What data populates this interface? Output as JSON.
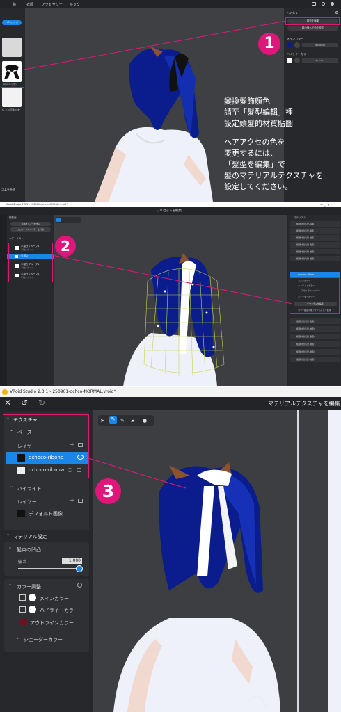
{
  "p1": {
    "tabs": [
      "體",
      "衣服",
      "アクセサリー",
      "ルック"
    ],
    "left": {
      "top_button": "ヘアスタイル",
      "item_caption": "qchoco-リボン",
      "item2_caption": "Tu_リ-ル宣言3/2枚"
    },
    "bottom": "ゴムを外す",
    "right": {
      "title": "ヘアカラー",
      "edit_button": "髪型を編集",
      "reset_button": "最小値ヘア色を設定",
      "main_label": "メインカラー",
      "main_hex": "#000000",
      "hl_label": "ハイライトカラー",
      "hl_hex": "#FFFFFF"
    },
    "note_zh": [
      "變換髮飾顏色",
      "請至「髮型編輯」裡",
      "設定頭髮的材質貼圖"
    ],
    "note_jp": [
      "ヘアアクセの色を",
      "変更するには、",
      "「髪型を編集」で",
      "髪のマテリアルテクスチャを",
      "設定してください。"
    ],
    "badge": "1"
  },
  "p2": {
    "window_title": "VRoid Studio 2.3.1 - 250901-qchco-NORMAL.vroid*",
    "header_title": "プリセットを編集",
    "left": {
      "title": "編集画",
      "btn1": "手描きヘアーを作る",
      "btn2": "プロシージャルヘアーを作る",
      "section": "ヘアーリスト",
      "groups": [
        "手描きグループ1",
        "手描きグループ1",
        "手描きグループ1"
      ],
      "sub": "手描きガイド",
      "selected": "リボン"
    },
    "right": {
      "title": "マテリアル",
      "items": [
        "極細材質毛髪-基準",
        "極細材質毛髪-筋毛",
        "極細材質毛髪-前毛",
        "極細材質毛髪-筋毛2",
        "極細材質毛髪-前毛2",
        "極細材質毛髪-前毛3"
      ],
      "selected": "qchoco-ribon",
      "sub1": "メインカラー",
      "sub2": "ハイライトカラー",
      "sub3": "アウトラインカラー",
      "sub4": "シェーダーカラー",
      "texture_btn": "テクスチャを編集",
      "check_text": "カラー設定可能アイテムとして使用",
      "items2": [
        "極細材質毛髪-筋毛4",
        "極細材質毛髪-前毛5",
        "極細材質毛髪-筋毛6",
        "極細材質毛髪-前毛7",
        "極細材質毛髪-筋毛8",
        "極細材質毛髪-前毛9"
      ]
    },
    "badge": "2"
  },
  "p3": {
    "window_title": "VRoid Studio 2.3.1 - 250901-qchco-NORMAL.vroid*",
    "header_title": "マテリアルテクスチャを編集",
    "texture_section": "テクスチャ",
    "base": "ベース",
    "layer": "レイヤー",
    "layers": [
      "qchoco-ribonb",
      "qchoco-ribonw"
    ],
    "highlight": "ハイライト",
    "layer2": "レイヤー",
    "default_image": "デフォルト画像",
    "material_settings": "マテリアル設定",
    "bump": "髪束の凹凸",
    "strength": "強さ",
    "strength_value": "1.000",
    "strength_level": 1.0,
    "color_adjust": "カラー調整",
    "main_color": "メインカラー",
    "hl_color": "ハイライトカラー",
    "outline_color": "アウトラインカラー",
    "shader_color": "シェーダーカラー",
    "badge": "3"
  },
  "colors": {
    "accent": "#e0177a",
    "select": "#1a86e8",
    "hair": "#0a1c8a"
  }
}
